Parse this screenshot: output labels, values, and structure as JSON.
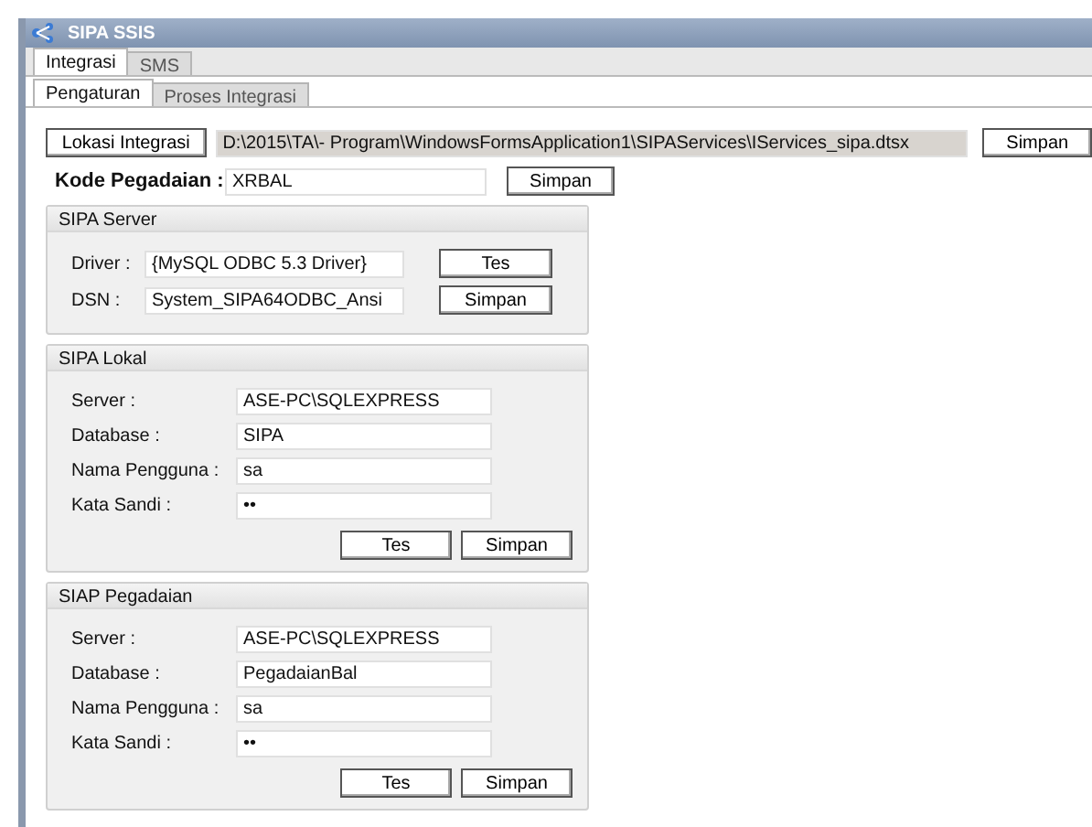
{
  "window": {
    "title": "SIPA SSIS"
  },
  "tabs": [
    {
      "label": "Integrasi",
      "selected": true
    },
    {
      "label": "SMS",
      "selected": false
    }
  ],
  "subtabs": [
    {
      "label": "Pengaturan",
      "selected": true
    },
    {
      "label": "Proses Integrasi",
      "selected": false
    }
  ],
  "location": {
    "button": "Lokasi Integrasi",
    "path": "D:\\2015\\TA\\- Program\\WindowsFormsApplication1\\SIPAServices\\IServices_sipa.dtsx",
    "save": "Simpan"
  },
  "code": {
    "label": "Kode Pegadaian :",
    "value": "XRBAL",
    "save": "Simpan"
  },
  "groups": [
    {
      "kind": "driver",
      "title": "SIPA Server",
      "fields": [
        {
          "label": "Driver :",
          "value": "{MySQL ODBC 5.3 Driver}"
        },
        {
          "label": "DSN :",
          "value": "System_SIPA64ODBC_Ansi"
        }
      ],
      "buttons": [
        "Tes",
        "Simpan"
      ]
    },
    {
      "kind": "connection",
      "title": "SIPA Lokal",
      "fields": [
        {
          "label": "Server :",
          "value": "ASE-PC\\SQLEXPRESS"
        },
        {
          "label": "Database :",
          "value": "SIPA"
        },
        {
          "label": "Nama Pengguna :",
          "value": "sa"
        },
        {
          "label": "Kata Sandi :",
          "value": "••"
        }
      ],
      "buttons": [
        "Tes",
        "Simpan"
      ]
    },
    {
      "kind": "connection",
      "title": "SIAP Pegadaian",
      "fields": [
        {
          "label": "Server :",
          "value": "ASE-PC\\SQLEXPRESS"
        },
        {
          "label": "Database :",
          "value": "PegadaianBal"
        },
        {
          "label": "Nama Pengguna :",
          "value": "sa"
        },
        {
          "label": "Kata Sandi :",
          "value": "••"
        }
      ],
      "buttons": [
        "Tes",
        "Simpan"
      ]
    }
  ]
}
